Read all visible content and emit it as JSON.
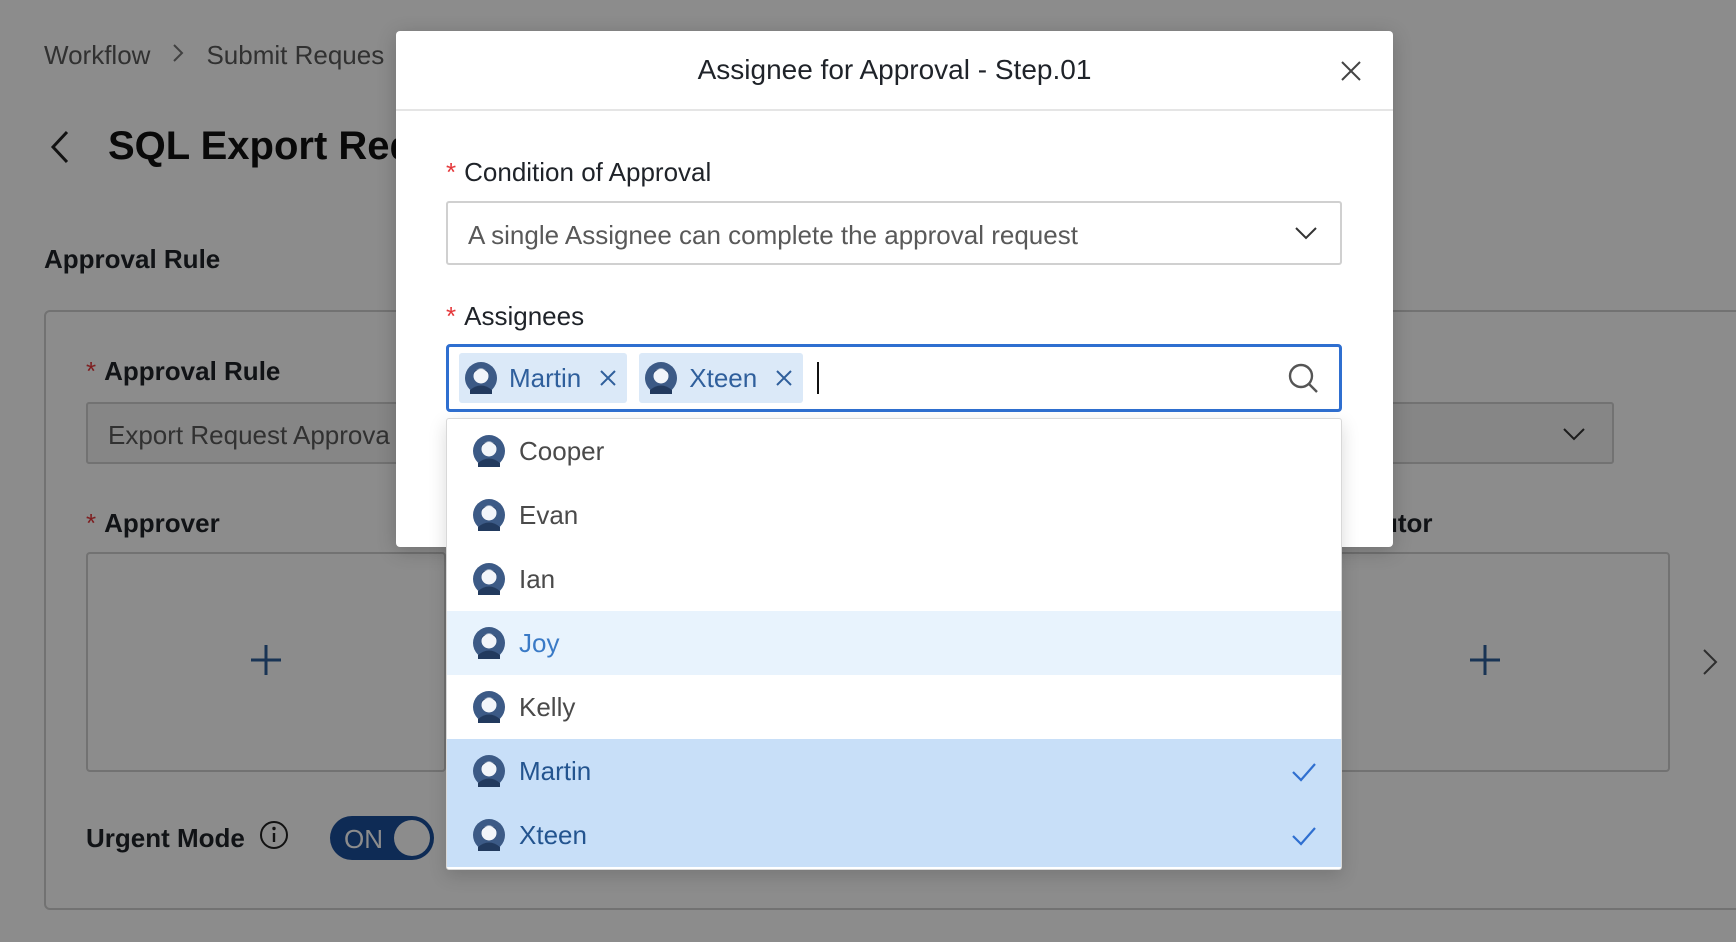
{
  "breadcrumb": {
    "items": [
      "Workflow",
      "Submit Reques"
    ]
  },
  "page": {
    "title": "SQL Export Req",
    "section_title": "Approval Rule",
    "approval_rule_label": "Approval Rule",
    "approval_rule_value": "Export Request Approva",
    "approver_label": "Approver",
    "executor_label_partial": "utor",
    "urgent_mode_label": "Urgent Mode",
    "urgent_toggle": "ON",
    "add_symbol": "+"
  },
  "modal": {
    "title": "Assignee for Approval - Step.01",
    "condition_label": "Condition of Approval",
    "condition_value": "A single Assignee can complete the approval request",
    "assignees_label": "Assignees",
    "selected_tags": [
      "Martin",
      "Xteen"
    ]
  },
  "dropdown": {
    "options": [
      "Cooper",
      "Evan",
      "Ian",
      "Joy",
      "Kelly",
      "Martin",
      "Xteen"
    ],
    "hovered": "Joy",
    "selected": [
      "Martin",
      "Xteen"
    ]
  },
  "colors": {
    "accent": "#2f6fd0",
    "tag_bg": "#dbe9f8",
    "selected_bg": "#c8dff8",
    "hover_bg": "#e8f3fd",
    "required": "#e5383b",
    "toggle_on": "#1a4f9c"
  },
  "required_mark": "*"
}
